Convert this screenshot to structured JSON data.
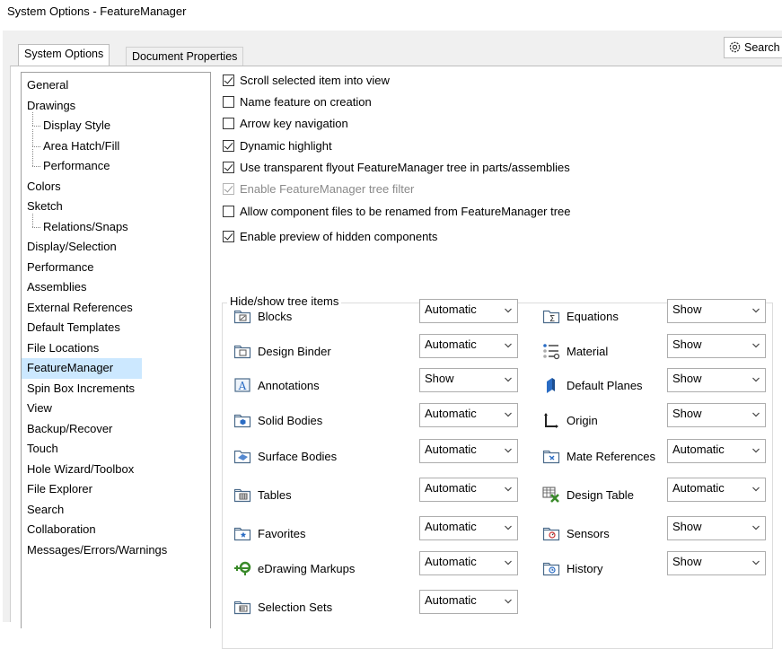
{
  "window_title": "System Options - FeatureManager",
  "tabs": [
    "System Options",
    "Document Properties"
  ],
  "search": {
    "label": "Search",
    "icon": "gear-icon"
  },
  "nav": [
    {
      "label": "General",
      "child": false
    },
    {
      "label": "Drawings",
      "child": false
    },
    {
      "label": "Display Style",
      "child": true
    },
    {
      "label": "Area Hatch/Fill",
      "child": true
    },
    {
      "label": "Performance",
      "child": true
    },
    {
      "label": "Colors",
      "child": false
    },
    {
      "label": "Sketch",
      "child": false
    },
    {
      "label": "Relations/Snaps",
      "child": true
    },
    {
      "label": "Display/Selection",
      "child": false
    },
    {
      "label": "Performance",
      "child": false
    },
    {
      "label": "Assemblies",
      "child": false
    },
    {
      "label": "External References",
      "child": false
    },
    {
      "label": "Default Templates",
      "child": false
    },
    {
      "label": "File Locations",
      "child": false
    },
    {
      "label": "FeatureManager",
      "child": false,
      "selected": true
    },
    {
      "label": "Spin Box Increments",
      "child": false
    },
    {
      "label": "View",
      "child": false
    },
    {
      "label": "Backup/Recover",
      "child": false
    },
    {
      "label": "Touch",
      "child": false
    },
    {
      "label": "Hole Wizard/Toolbox",
      "child": false
    },
    {
      "label": "File Explorer",
      "child": false
    },
    {
      "label": "Search",
      "child": false
    },
    {
      "label": "Collaboration",
      "child": false
    },
    {
      "label": "Messages/Errors/Warnings",
      "child": false
    }
  ],
  "options": [
    {
      "label": "Scroll selected item into view",
      "checked": true,
      "disabled": false
    },
    {
      "label": "Name feature on creation",
      "checked": false,
      "disabled": false
    },
    {
      "label": "Arrow key navigation",
      "checked": false,
      "disabled": false
    },
    {
      "label": "Dynamic highlight",
      "checked": true,
      "disabled": false
    },
    {
      "label": "Use transparent flyout FeatureManager tree in parts/assemblies",
      "checked": true,
      "disabled": false
    },
    {
      "label": "Enable FeatureManager tree filter",
      "checked": true,
      "disabled": true
    },
    {
      "label": "Allow component files to be renamed from FeatureManager tree",
      "checked": false,
      "disabled": false
    },
    {
      "label": "Enable preview of hidden components",
      "checked": true,
      "disabled": false
    }
  ],
  "tree_group_title": "Hide/show tree items",
  "tree_items_left": [
    {
      "label": "Blocks",
      "value": "Automatic",
      "icon": "blocks-folder-icon"
    },
    {
      "label": "Design Binder",
      "value": "Automatic",
      "icon": "design-binder-folder-icon"
    },
    {
      "label": "Annotations",
      "value": "Show",
      "icon": "annotations-folder-icon"
    },
    {
      "label": "Solid Bodies",
      "value": "Automatic",
      "icon": "solid-bodies-folder-icon"
    },
    {
      "label": "Surface Bodies",
      "value": "Automatic",
      "icon": "surface-bodies-folder-icon"
    },
    {
      "label": "Tables",
      "value": "Automatic",
      "icon": "tables-folder-icon"
    },
    {
      "label": "Favorites",
      "value": "Automatic",
      "icon": "favorites-folder-icon"
    },
    {
      "label": "eDrawing Markups",
      "value": "Automatic",
      "icon": "edrawing-markups-icon"
    },
    {
      "label": "Selection Sets",
      "value": "Automatic",
      "icon": "selection-sets-folder-icon"
    }
  ],
  "tree_items_right": [
    {
      "label": "Equations",
      "value": "Show",
      "icon": "equations-folder-icon"
    },
    {
      "label": "Material",
      "value": "Show",
      "icon": "material-icon"
    },
    {
      "label": "Default Planes",
      "value": "Show",
      "icon": "default-planes-icon"
    },
    {
      "label": "Origin",
      "value": "Show",
      "icon": "origin-icon"
    },
    {
      "label": "Mate References",
      "value": "Automatic",
      "icon": "mate-references-folder-icon"
    },
    {
      "label": "Design Table",
      "value": "Automatic",
      "icon": "design-table-icon"
    },
    {
      "label": "Sensors",
      "value": "Show",
      "icon": "sensors-folder-icon"
    },
    {
      "label": "History",
      "value": "Show",
      "icon": "history-folder-icon"
    }
  ],
  "colors": {
    "selected_bg": "#cce8ff",
    "folder": "#4a6a8a",
    "accent_blue": "#2a6cc4",
    "green": "#3a8a2a"
  }
}
